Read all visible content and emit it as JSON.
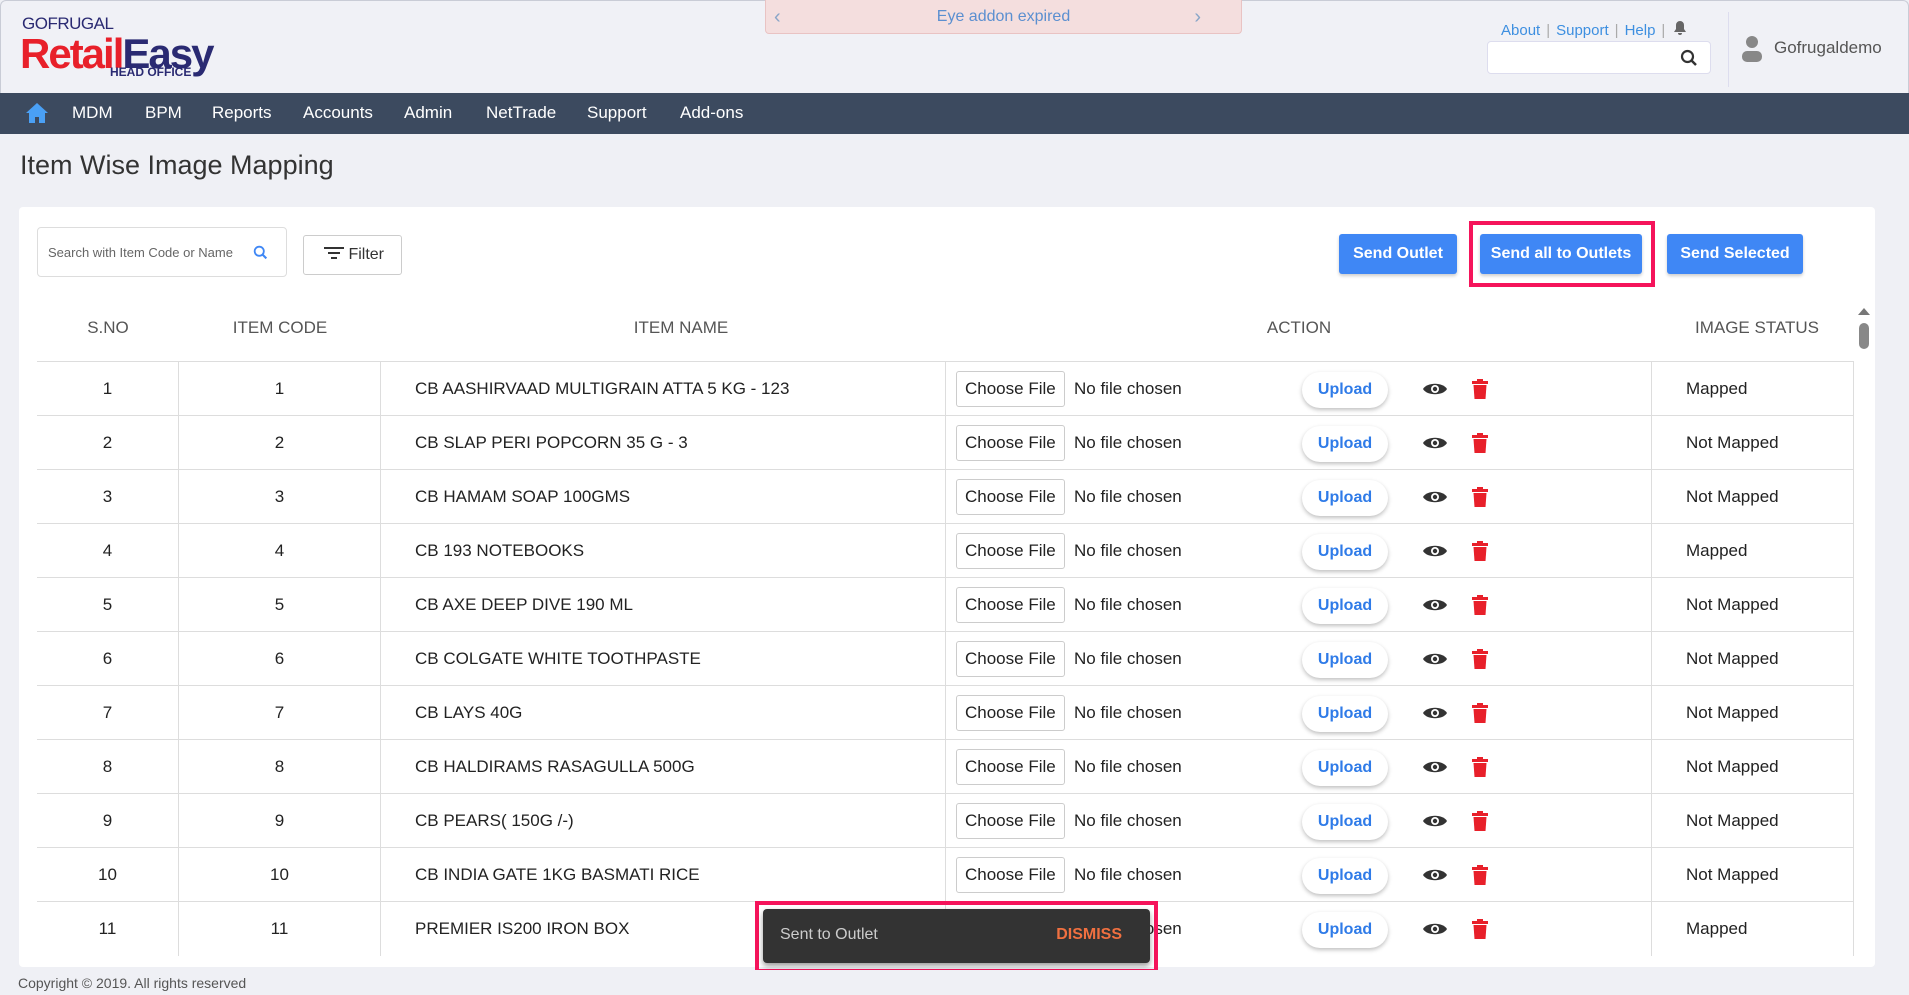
{
  "brand": {
    "top": "GOFRUGAL",
    "main_red": "Retail",
    "main_blue": "Easy",
    "sub": "HEAD OFFICE"
  },
  "banner": {
    "text": "Eye addon expired"
  },
  "toplinks": [
    "About",
    "Support",
    "Help"
  ],
  "user": {
    "name": "Gofrugaldemo"
  },
  "nav": [
    "MDM",
    "BPM",
    "Reports",
    "Accounts",
    "Admin",
    "NetTrade",
    "Support",
    "Add-ons"
  ],
  "page_title": "Item Wise Image Mapping",
  "toolbar": {
    "search_placeholder": "Search with Item Code or Name",
    "filter": "Filter",
    "send_outlet": "Send Outlet",
    "send_all": "Send all to Outlets",
    "send_selected": "Send Selected"
  },
  "table": {
    "headers": [
      "S.NO",
      "ITEM CODE",
      "ITEM NAME",
      "ACTION",
      "IMAGE STATUS"
    ],
    "choose_label": "Choose File",
    "no_file": "No file chosen",
    "upload_label": "Upload",
    "rows": [
      {
        "sno": "1",
        "code": "1",
        "name": "CB AASHIRVAAD MULTIGRAIN ATTA 5 KG - 123",
        "status": "Mapped"
      },
      {
        "sno": "2",
        "code": "2",
        "name": "CB SLAP PERI POPCORN 35 G - 3",
        "status": "Not Mapped"
      },
      {
        "sno": "3",
        "code": "3",
        "name": "CB HAMAM SOAP 100GMS",
        "status": "Not Mapped"
      },
      {
        "sno": "4",
        "code": "4",
        "name": "CB 193 NOTEBOOKS",
        "status": "Mapped"
      },
      {
        "sno": "5",
        "code": "5",
        "name": "CB AXE DEEP DIVE 190 ML",
        "status": "Not Mapped"
      },
      {
        "sno": "6",
        "code": "6",
        "name": "CB COLGATE WHITE TOOTHPASTE",
        "status": "Not Mapped"
      },
      {
        "sno": "7",
        "code": "7",
        "name": "CB LAYS 40G",
        "status": "Not Mapped"
      },
      {
        "sno": "8",
        "code": "8",
        "name": "CB HALDIRAMS RASAGULLA 500G",
        "status": "Not Mapped"
      },
      {
        "sno": "9",
        "code": "9",
        "name": "CB PEARS( 150G /-)",
        "status": "Not Mapped"
      },
      {
        "sno": "10",
        "code": "10",
        "name": "CB INDIA GATE 1KG BASMATI RICE",
        "status": "Not Mapped"
      },
      {
        "sno": "11",
        "code": "11",
        "name": "PREMIER IS200 IRON BOX",
        "status": "Mapped"
      }
    ]
  },
  "toast": {
    "message": "Sent to Outlet",
    "action": "DISMISS"
  },
  "footer": "Copyright © 2019. All rights reserved",
  "colors": {
    "nav": "#3c4a5f",
    "primary": "#3f87f5",
    "highlight": "#f5145b",
    "delete": "#e8202a",
    "dismiss": "#f07040"
  }
}
